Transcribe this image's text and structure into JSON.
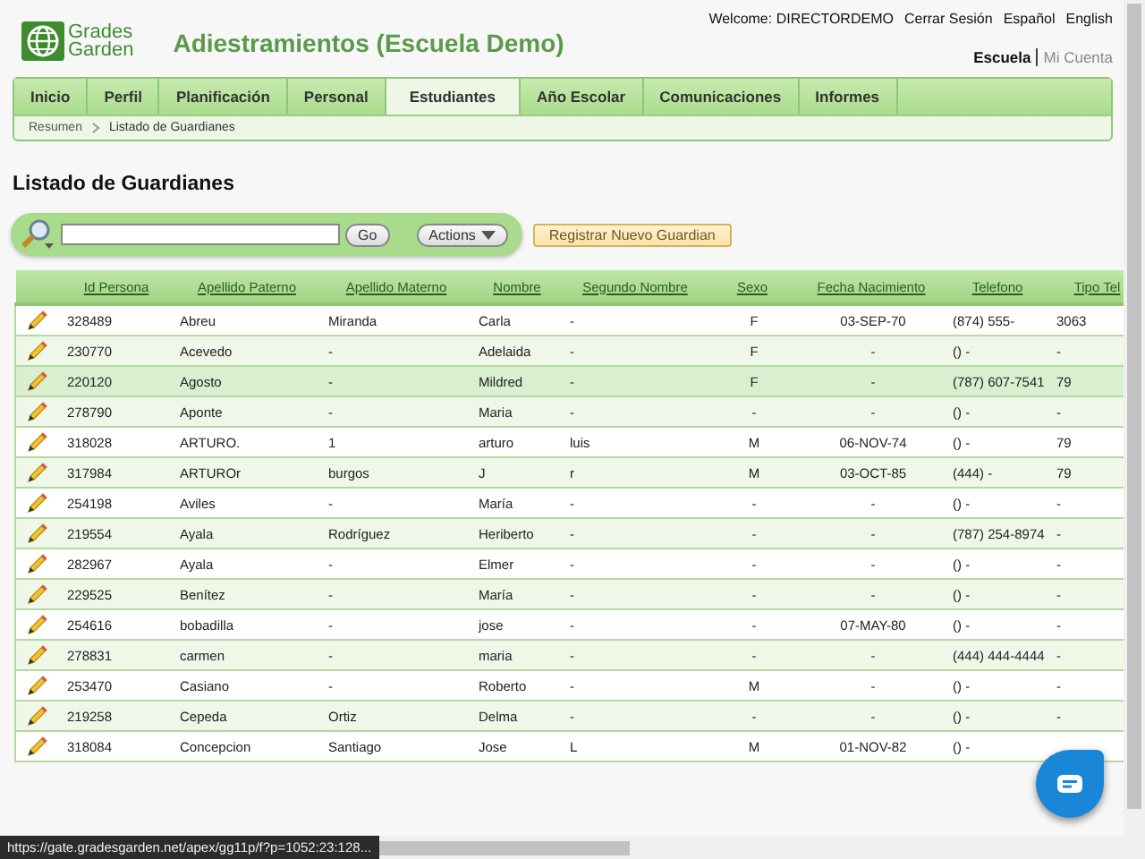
{
  "header": {
    "logo_line_1": "Grades",
    "logo_line_2": "Garden",
    "title": "Adiestramientos (Escuela Demo)",
    "welcome_label": "Welcome:",
    "user": "DIRECTORDEMO",
    "links": [
      "Cerrar Sesión",
      "Español",
      "English"
    ],
    "context_links": [
      {
        "label": "Escuela",
        "selected": true
      },
      {
        "label": "Mi Cuenta",
        "selected": false
      }
    ]
  },
  "tabs": [
    {
      "label": "Inicio",
      "selected": false
    },
    {
      "label": "Perfil",
      "selected": false
    },
    {
      "label": "Planificación",
      "selected": false
    },
    {
      "label": "Personal",
      "selected": false
    },
    {
      "label": "Estudiantes",
      "selected": true
    },
    {
      "label": "Año Escolar",
      "selected": false
    },
    {
      "label": "Comunicaciones",
      "selected": false
    },
    {
      "label": "Informes",
      "selected": false
    }
  ],
  "breadcrumb": [
    "Resumen",
    "Listado de Guardianes"
  ],
  "page_title": "Listado de Guardianes",
  "toolbar": {
    "go": "Go",
    "actions": "Actions",
    "register": "Registrar Nuevo Guardian"
  },
  "table": {
    "columns": [
      "Id Persona",
      "Apellido Paterno",
      "Apellido Materno",
      "Nombre",
      "Segundo Nombre",
      "Sexo",
      "Fecha Nacimiento",
      "Telefono",
      "Tipo Tel"
    ],
    "rows": [
      {
        "selected": false,
        "cells": [
          "328489",
          "Abreu",
          "Miranda",
          "Carla",
          "-",
          "F",
          "03-SEP-70",
          "(874) 555-",
          "3063"
        ]
      },
      {
        "selected": false,
        "cells": [
          "230770",
          "Acevedo",
          "-",
          "Adelaida",
          "-",
          "F",
          "-",
          "() -",
          "-"
        ]
      },
      {
        "selected": true,
        "cells": [
          "220120",
          "Agosto",
          "-",
          "Mildred",
          "-",
          "F",
          "-",
          "(787) 607-7541",
          "79"
        ]
      },
      {
        "selected": false,
        "cells": [
          "278790",
          "Aponte",
          "-",
          "Maria",
          "-",
          "-",
          "-",
          "() -",
          "-"
        ]
      },
      {
        "selected": false,
        "cells": [
          "318028",
          "ARTURO.",
          "1",
          "arturo",
          "luis",
          "M",
          "06-NOV-74",
          "() -",
          "79"
        ]
      },
      {
        "selected": false,
        "cells": [
          "317984",
          "ARTUROr",
          "burgos",
          "J",
          "r",
          "M",
          "03-OCT-85",
          "(444) -",
          "79"
        ]
      },
      {
        "selected": false,
        "cells": [
          "254198",
          "Aviles",
          "-",
          "María",
          "-",
          "-",
          "-",
          "() -",
          "-"
        ]
      },
      {
        "selected": false,
        "cells": [
          "219554",
          "Ayala",
          "Rodríguez",
          "Heriberto",
          "-",
          "-",
          "-",
          "(787) 254-8974",
          "-"
        ]
      },
      {
        "selected": false,
        "cells": [
          "282967",
          "Ayala",
          "-",
          "Elmer",
          "-",
          "-",
          "-",
          "() -",
          "-"
        ]
      },
      {
        "selected": false,
        "cells": [
          "229525",
          "Benítez",
          "-",
          "María",
          "-",
          "-",
          "-",
          "() -",
          "-"
        ]
      },
      {
        "selected": false,
        "cells": [
          "254616",
          "bobadilla",
          "-",
          "jose",
          "-",
          "-",
          "07-MAY-80",
          "() -",
          "-"
        ]
      },
      {
        "selected": false,
        "cells": [
          "278831",
          "carmen",
          "-",
          "maria",
          "-",
          "-",
          "-",
          "(444) 444-4444",
          "-"
        ]
      },
      {
        "selected": false,
        "cells": [
          "253470",
          "Casiano",
          "-",
          "Roberto",
          "-",
          "M",
          "-",
          "() -",
          "-"
        ]
      },
      {
        "selected": false,
        "cells": [
          "219258",
          "Cepeda",
          "Ortiz",
          "Delma",
          "-",
          "-",
          "-",
          "() -",
          "-"
        ]
      },
      {
        "selected": false,
        "cells": [
          "318084",
          "Concepcion",
          "Santiago",
          "Jose",
          "L",
          "M",
          "01-NOV-82",
          "() -"
        ]
      }
    ]
  },
  "status_url": "https://gate.gradesgarden.net/apex/gg11p/f?p=1052:23:128..."
}
